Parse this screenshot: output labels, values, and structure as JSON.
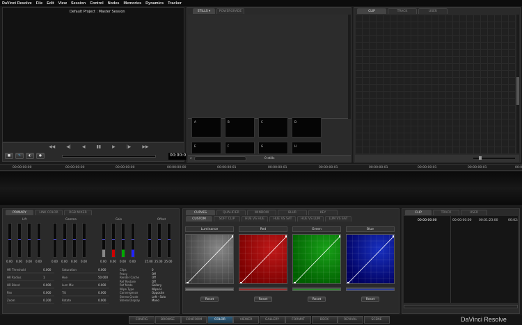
{
  "menu": [
    "DaVinci Resolve",
    "File",
    "Edit",
    "View",
    "Session",
    "Control",
    "Nodes",
    "Memories",
    "Dynamics",
    "Tracker"
  ],
  "viewer": {
    "project_title": "Default Project : Master Session",
    "timecode": "00:00:0"
  },
  "stills": {
    "tabs": [
      "STILLS ▾",
      "POWERGRADE"
    ],
    "items": [
      "A",
      "B",
      "C",
      "D",
      "E",
      "F",
      "G",
      "H"
    ],
    "search_placeholder": "",
    "count": "0 stills"
  },
  "clip_panel_top": {
    "tabs": [
      "CLIP",
      "TRACK",
      "USER"
    ]
  },
  "timeline": {
    "timecodes": [
      "00:00:00:00",
      "00:00:00:00",
      "00:00:00:00",
      "00:00:00:00",
      "00:00:00:01",
      "00:00:00:01",
      "00:00:00:01",
      "00:00:00:01",
      "00:00:00:01",
      "00:00:00:01",
      "00:00:00:01"
    ]
  },
  "primary": {
    "tabs": [
      "PRIMARY",
      "LINK COLOR",
      "RGB MIXER"
    ],
    "groups": [
      "Lift",
      "Gamma",
      "Gain",
      "Offset"
    ],
    "lift_values": [
      "0.00",
      "0.00",
      "0.00",
      "0.00"
    ],
    "gamma_values": [
      "0.00",
      "0.00",
      "0.00",
      "0.00"
    ],
    "gain_values": [
      "0.00",
      "0.00",
      "0.00",
      "0.00"
    ],
    "offset_values": [
      "25.00",
      "25.00",
      "25.00"
    ],
    "params_left": [
      {
        "label": "HR Threshold",
        "value": "0.000"
      },
      {
        "label": "HR Radius",
        "value": "1"
      },
      {
        "label": "HR Blend",
        "value": "0.000"
      },
      {
        "label": "Pan",
        "value": "0.000"
      },
      {
        "label": "Zoom",
        "value": "0.200"
      }
    ],
    "params_mid": [
      {
        "label": "Saturation",
        "value": "0.000"
      },
      {
        "label": "Hue",
        "value": "50.000"
      },
      {
        "label": "Lum Mix",
        "value": "0.000"
      },
      {
        "label": "Tilt",
        "value": "0.000"
      },
      {
        "label": "Rotate",
        "value": "0.000"
      }
    ],
    "params_right": [
      {
        "label": "Clips",
        "value": "0"
      },
      {
        "label": "Proxy",
        "value": "Off"
      },
      {
        "label": "Render Cache",
        "value": "Off"
      },
      {
        "label": "Ref Restore",
        "value": "Off"
      },
      {
        "label": "Ref Mode",
        "value": "Gallery"
      },
      {
        "label": "Wipe Type",
        "value": "Wipe H"
      },
      {
        "label": "Convergence",
        "value": "Opposite"
      },
      {
        "label": "Stereo Grade",
        "value": "Left - Solo"
      },
      {
        "label": "Stereo Display",
        "value": "Mono"
      }
    ]
  },
  "curves": {
    "tabs_row1": [
      "CURVES",
      "QUALIFIER",
      "WINDOW",
      "BLUR",
      "KEY"
    ],
    "tabs_row2": [
      "CUSTOM",
      "SOFT CLIP",
      "HUE VS HUE",
      "HUE VS SAT",
      "HUE VS LUM",
      "LUM VS SAT"
    ],
    "channels": [
      {
        "name": "Luminance",
        "reset": "Reset",
        "color": "#888888"
      },
      {
        "name": "Red",
        "reset": "Reset",
        "color": "#c01818"
      },
      {
        "name": "Green",
        "reset": "Reset",
        "color": "#18a018"
      },
      {
        "name": "Blue",
        "reset": "Reset",
        "color": "#1830c0"
      }
    ]
  },
  "clip_panel_bottom": {
    "tabs": [
      "CLIP",
      "TRACK",
      "USER"
    ],
    "timecodes": [
      "00:00:00:00",
      "00:00:00:00",
      "00:01:23:00",
      "00:02:"
    ]
  },
  "bottom_tabs": [
    "CONFIG",
    "BROWSE",
    "CONFORM",
    "COLOR",
    "VIEWER",
    "GALLERY",
    "FORMAT",
    "DECK",
    "REVIVAL",
    "SCENE"
  ],
  "brand": "DaVinci Resolve"
}
